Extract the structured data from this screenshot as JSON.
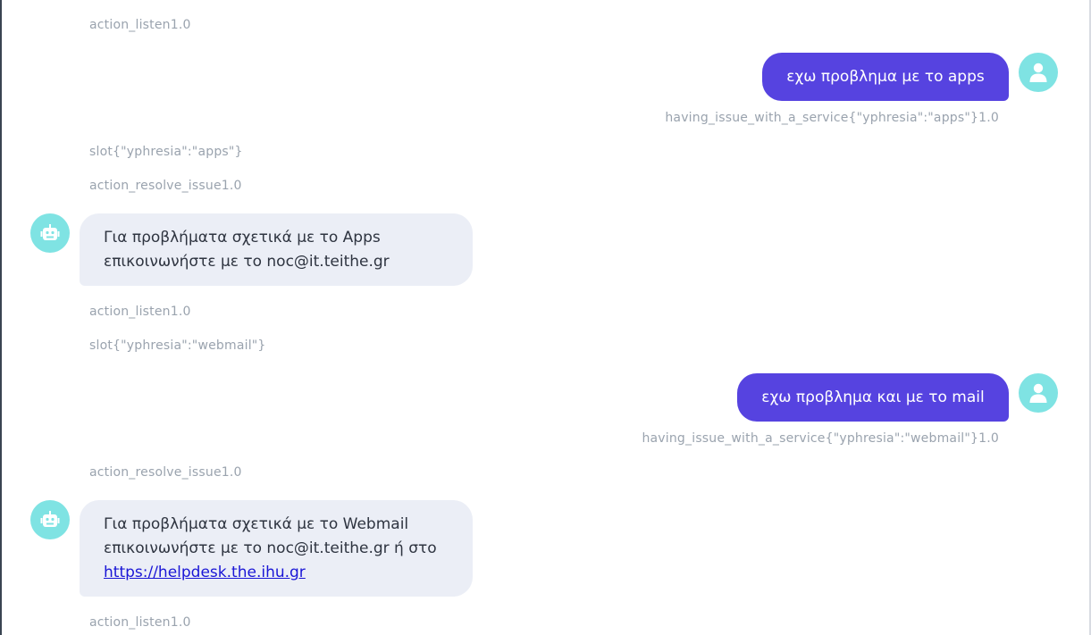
{
  "messages": [
    {
      "type": "meta",
      "text": "action_listen1.0"
    },
    {
      "type": "user",
      "text": "εχω προβλημα με το apps"
    },
    {
      "type": "meta",
      "text": "having_issue_with_a_service{\"yphresia\":\"apps\"}1.0"
    },
    {
      "type": "meta",
      "text": "slot{\"yphresia\":\"apps\"}"
    },
    {
      "type": "meta",
      "text": "action_resolve_issue1.0"
    },
    {
      "type": "bot",
      "line1": "Για προβλήματα σχετικά με το Apps",
      "line2": "επικοινωνήστε με το noc@it.teithe.gr"
    },
    {
      "type": "meta",
      "text": "action_listen1.0"
    },
    {
      "type": "meta",
      "text": "slot{\"yphresia\":\"webmail\"}"
    },
    {
      "type": "user",
      "text": "εχω προβλημα και με το mail"
    },
    {
      "type": "meta",
      "text": "having_issue_with_a_service{\"yphresia\":\"webmail\"}1.0"
    },
    {
      "type": "meta",
      "text": "action_resolve_issue1.0"
    },
    {
      "type": "bot",
      "line1": "Για προβλήματα σχετικά με το Webmail",
      "line2": "επικοινωνήστε με το noc@it.teithe.gr ή στο",
      "link": "https://helpdesk.the.ihu.gr"
    },
    {
      "type": "meta",
      "text": "action_listen1.0"
    }
  ],
  "colors": {
    "user_bubble": "#5643e0",
    "bot_bubble": "#ebeef6",
    "avatar": "#7fe3e3",
    "meta_text": "#9aa3ae",
    "link": "#1a16d6"
  },
  "icons": {
    "user": "person-icon",
    "bot": "robot-icon"
  }
}
